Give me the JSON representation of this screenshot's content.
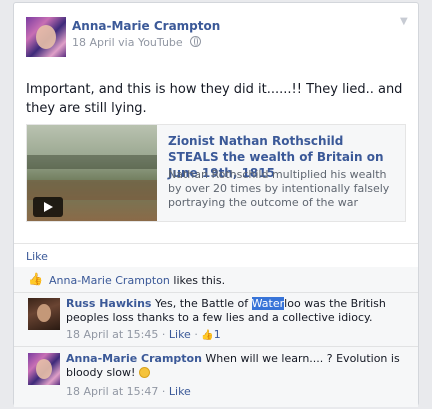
{
  "post": {
    "author": "Anna-Marie Crampton",
    "date": "18 April",
    "via": "via YouTube",
    "text": "Important, and this is how they did it......!! They lied.. and they are still lying.",
    "link": {
      "title": "Zionist Nathan Rothschild STEALS the wealth of Britain on June 19th, 1815",
      "description": "Nathan Rothschild multiplied his wealth by over 20 times by intentionally falsely portraying the outcome of the war between"
    },
    "like_label": "Like"
  },
  "likes": {
    "name": "Anna-Marie Crampton",
    "suffix": " likes this."
  },
  "comments": [
    {
      "author": "Russ Hawkins",
      "text_before": " Yes, the Battle of ",
      "highlight": "Water",
      "text_after": "loo was the British peoples loss thanks to a few lies and a collective idiocy.",
      "time": "18 April at 15:45",
      "like_label": "Like",
      "like_count": "1"
    },
    {
      "author": "Anna-Marie Crampton",
      "text": " When will we learn.... ? Evolution is bloody slow! ",
      "time": "18 April at 15:47",
      "like_label": "Like"
    }
  ],
  "icons": {
    "globe": "globe-icon",
    "thumbs_up": "thumbs-up-icon",
    "play": "play-icon",
    "smile": "smiley-emoticon"
  },
  "colors": {
    "link_blue": "#3b5998",
    "meta_grey": "#9197a3",
    "selection": "#3874d8"
  }
}
